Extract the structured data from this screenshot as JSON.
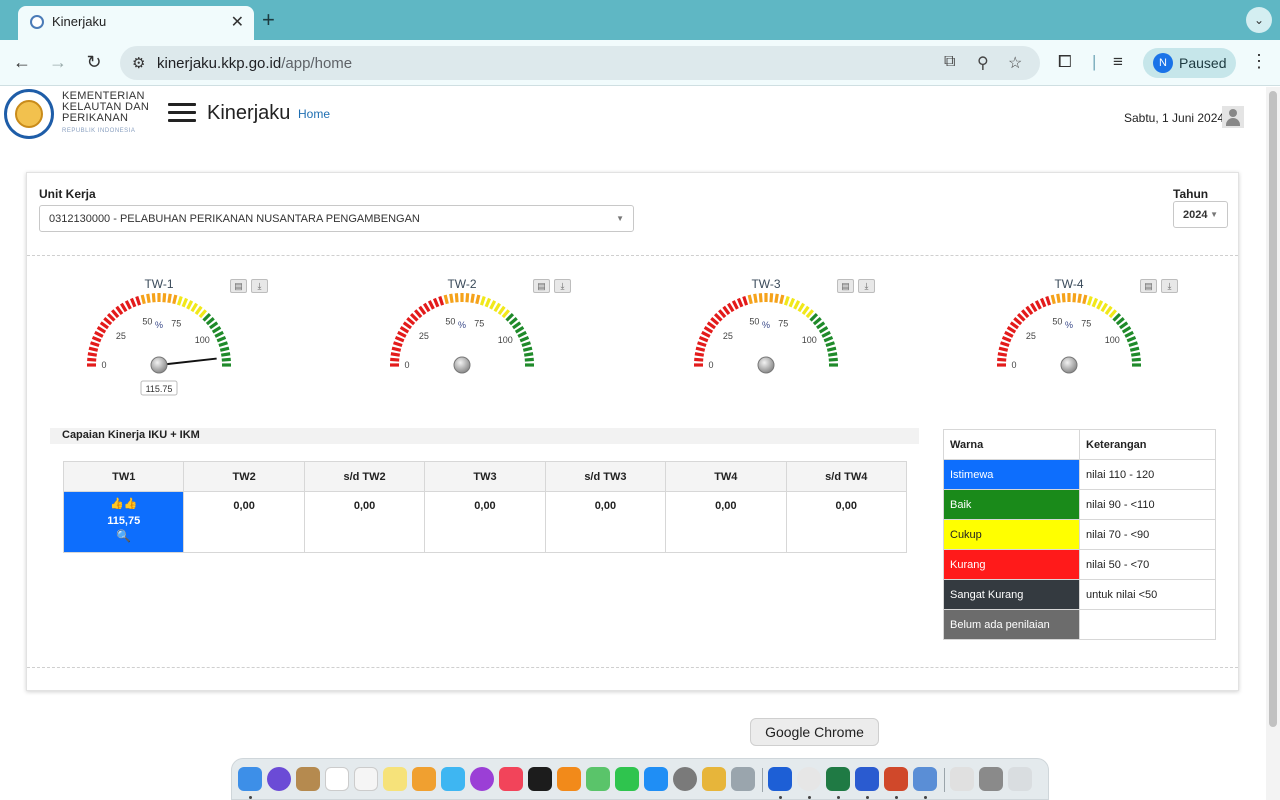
{
  "browser": {
    "tab_title": "Kinerjaku",
    "url_host": "kinerjaku.kkp.go.id",
    "url_path": "/app/home",
    "profile_initial": "N",
    "profile_label": "Paused",
    "tooltip": "Google Chrome"
  },
  "header": {
    "logo_line1": "KEMENTERIAN",
    "logo_line2": "KELAUTAN DAN",
    "logo_line3": "PERIKANAN",
    "logo_sub": "REPUBLIK INDONESIA",
    "app_title": "Kinerjaku",
    "breadcrumb": "Home",
    "date": "Sabtu, 1 Juni 2024"
  },
  "filters": {
    "unit_label": "Unit Kerja",
    "unit_value": "0312130000 - PELABUHAN PERIKANAN NUSANTARA PENGAMBENGAN",
    "year_label": "Tahun",
    "year_value": "2024"
  },
  "gauges": [
    {
      "title": "TW-1",
      "value": 115.75,
      "value_label": "115.75"
    },
    {
      "title": "TW-2",
      "value": null,
      "value_label": ""
    },
    {
      "title": "TW-3",
      "value": null,
      "value_label": ""
    },
    {
      "title": "TW-4",
      "value": null,
      "value_label": ""
    }
  ],
  "gauge_scale": {
    "min_label": "0",
    "t25": "25",
    "t50": "50",
    "t75": "75",
    "t100": "100",
    "unit": "%"
  },
  "capaian": {
    "title": "Capaian Kinerja IKU + IKM",
    "headers": [
      "TW1",
      "TW2",
      "s/d TW2",
      "TW3",
      "s/d TW3",
      "TW4",
      "s/d TW4"
    ],
    "tw1_thumbs": "👍👍",
    "tw1_value": "115,75",
    "tw1_search": "🔍",
    "values": [
      "0,00",
      "0,00",
      "0,00",
      "0,00",
      "0,00",
      "0,00"
    ]
  },
  "legend": {
    "header_warna": "Warna",
    "header_keterangan": "Keterangan",
    "rows": [
      {
        "warna": "Istimewa",
        "keterangan": "nilai 110 - 120",
        "bg": "#0d6efd",
        "fg": "#ffffff"
      },
      {
        "warna": "Baik",
        "keterangan": "nilai 90 - <110",
        "bg": "#1a8a1a",
        "fg": "#ffffff"
      },
      {
        "warna": "Cukup",
        "keterangan": "nilai 70 - <90",
        "bg": "#ffff00",
        "fg": "#222222"
      },
      {
        "warna": "Kurang",
        "keterangan": "nilai 50 - <70",
        "bg": "#ff1a1a",
        "fg": "#ffffff"
      },
      {
        "warna": "Sangat Kurang",
        "keterangan": "untuk nilai <50",
        "bg": "#343a40",
        "fg": "#ffffff"
      },
      {
        "warna": "Belum ada penilaian",
        "keterangan": "",
        "bg": "#6c6c6c",
        "fg": "#ffffff"
      }
    ]
  }
}
